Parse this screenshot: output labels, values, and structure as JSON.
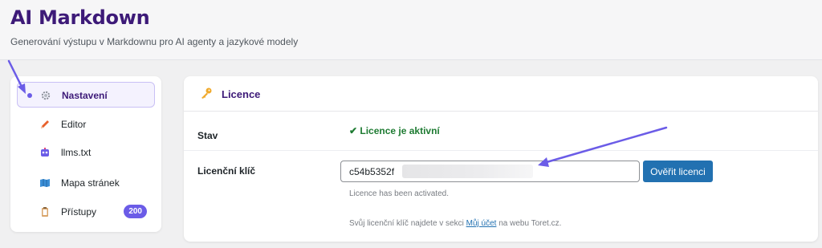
{
  "header": {
    "title": "AI Markdown",
    "subtitle": "Generování výstupu v Markdownu pro AI agenty a jazykové modely"
  },
  "sidebar": {
    "items": [
      {
        "label": "Nastavení",
        "icon": "gear-icon",
        "active": true
      },
      {
        "label": "Editor",
        "icon": "pencil-icon"
      },
      {
        "label": "llms.txt",
        "icon": "robot-icon"
      },
      {
        "label": "Mapa stránek",
        "icon": "map-icon"
      },
      {
        "label": "Přístupy",
        "icon": "clipboard-icon",
        "badge": "200"
      }
    ]
  },
  "panel": {
    "title": "Licence",
    "icon": "key-icon",
    "status_label": "Stav",
    "status_value": "✔ Licence je aktivní",
    "key_label": "Licenční klíč",
    "key_value": "c54b5352f",
    "verify_label": "Ověřit licenci",
    "activated_hint": "Licence has been activated.",
    "note_before": "Svůj licenční klíč najdete v sekci ",
    "note_link": "Můj účet",
    "note_after": " na webu Toret.cz."
  },
  "colors": {
    "brand": "#3d1a78",
    "accent": "#6b5ce7",
    "primary_button": "#2271b1",
    "success": "#1e7b32"
  }
}
